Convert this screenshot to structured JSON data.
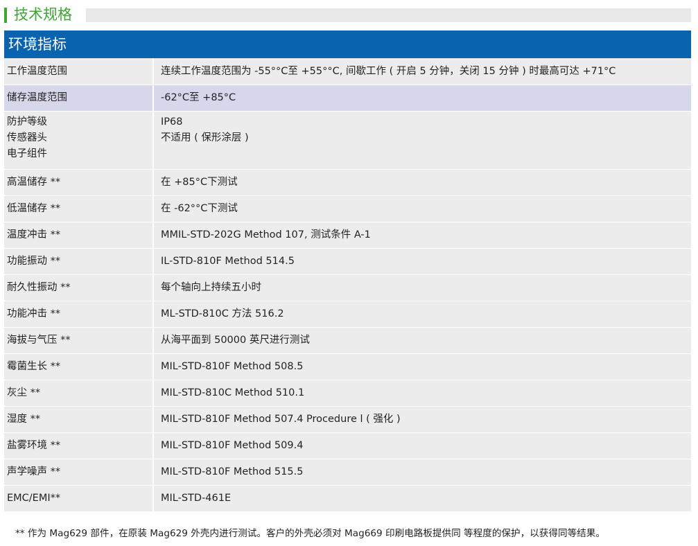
{
  "section": {
    "title": "技术规格"
  },
  "table": {
    "header": "环境指标",
    "rows": [
      {
        "label": "工作温度范围",
        "value": "连续工作温度范围为 -55°°C至 +55°°C, 间歇工作 ( 开启 5 分钟，关闭 15 分钟 ) 时最高可达 +71°C"
      },
      {
        "label": "储存温度范围",
        "value": "-62°C至 +85°C",
        "highlight": true
      },
      {
        "label": "防护等级\n传感器头\n电子组件",
        "value": "IP68\n不适用 ( 保形涂层 )"
      },
      {
        "label": "高温储存 **",
        "value": "在 +85°C下测试"
      },
      {
        "label": "低温储存 **",
        "value": "在 -62°°C下测试"
      },
      {
        "label": "温度冲击 **",
        "value": "MMIL-STD-202G Method 107, 测试条件 A-1"
      },
      {
        "label": "功能振动 **",
        "value": "IL-STD-810F Method 514.5"
      },
      {
        "label": "耐久性振动 **",
        "value": "每个轴向上持续五小时"
      },
      {
        "label": "功能冲击 **",
        "value": "ML-STD-810C 方法 516.2"
      },
      {
        "label": "海拔与气压 **",
        "value": "从海平面到 50000 英尺进行测试"
      },
      {
        "label": "霉菌生长 **",
        "value": "MIL-STD-810F Method 508.5"
      },
      {
        "label": "灰尘 **",
        "value": "MIL-STD-810C Method 510.1"
      },
      {
        "label": "湿度 **",
        "value": "MIL-STD-810F Method 507.4 Procedure l ( 强化 )"
      },
      {
        "label": "盐雾环境 **",
        "value": "MIL-STD-810F Method 509.4"
      },
      {
        "label": "声学噪声 **",
        "value": "MIL-STD-810F Method 515.5"
      },
      {
        "label": "EMC/EMI**",
        "value": "MIL-STD-461E"
      }
    ]
  },
  "footnote": "** 作为 Mag629 部件，在原装 Mag629 外壳内进行测试。客户的外壳必须对 Mag669 印刷电路板提供同 等程度的保护，以获得同等结果。",
  "colors": {
    "accent_green": "#3fa535",
    "header_blue": "#0a63ae",
    "row_gray": "#ececec",
    "row_highlight": "#d6d7eb"
  }
}
